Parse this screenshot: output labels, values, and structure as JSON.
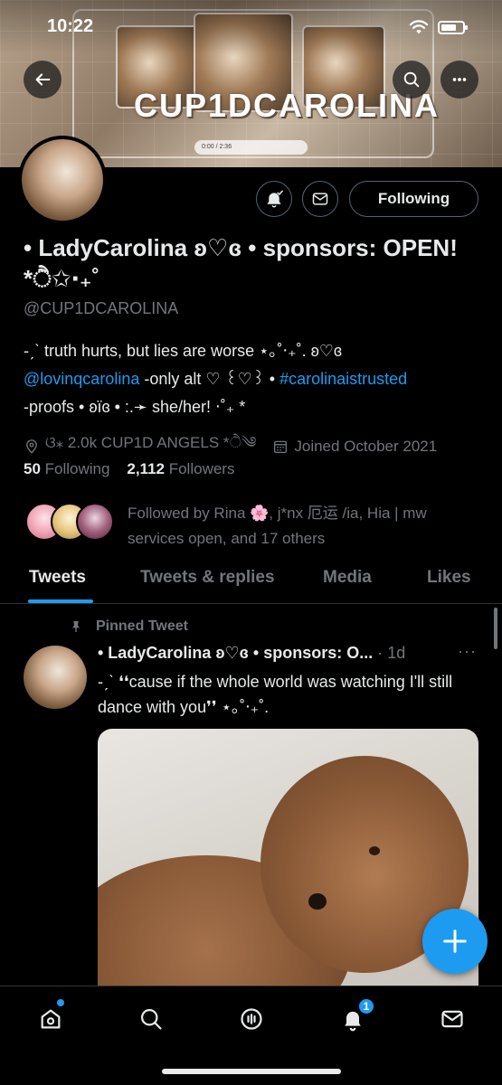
{
  "status_bar": {
    "time": "10:22"
  },
  "banner": {
    "title": "CUP1DCAROLINA",
    "player_time": "0:00 / 2:36"
  },
  "profile": {
    "display_name": "• LadyCarolina ʚ♡ɞ • sponsors: OPEN! *ੈ✩‧₊˚",
    "handle": "@CUP1DCAROLINA",
    "follow_button": "Following",
    "bio": {
      "line1": "-ˏˋ truth hurts, but lies are worse ⋆｡˚‧₊˚. ʚ♡ɞ",
      "line2_link1": "@lovinqcarolina",
      "line2_text": " -only alt ♡ ꒰♡꒱ • ",
      "line2_link2": "#carolinaistrusted",
      "line3": "-proofs • ʚïɞ • :.➛ she/her! ‧˚₊ *"
    },
    "location": "ଓ⁎ 2.0k CUP1D ANGELS *ੈ༄",
    "joined": "Joined October 2021",
    "following_count": "50",
    "following_label": "Following",
    "followers_count": "2,112",
    "followers_label": "Followers",
    "followed_by": "Followed by Rina 🌸, j*nx 厄运 /ia, Hia | mw services open, and 17 others"
  },
  "tabs": [
    "Tweets",
    "Tweets & replies",
    "Media",
    "Likes"
  ],
  "tweet": {
    "pinned_label": "Pinned Tweet",
    "author": "• LadyCarolina ʚ♡ɞ • sponsors: O...",
    "time": "· 1d",
    "more": "···",
    "text": "-ˏˋ ❛❛cause if the whole world was watching I'll still dance with you❜❜ ⋆｡˚‧₊˚."
  },
  "bottom_nav": {
    "notifications_badge": "1"
  },
  "colors": {
    "accent": "#1d9bf0",
    "background": "#000000",
    "muted": "#71767b",
    "text": "#e7e9ea"
  }
}
